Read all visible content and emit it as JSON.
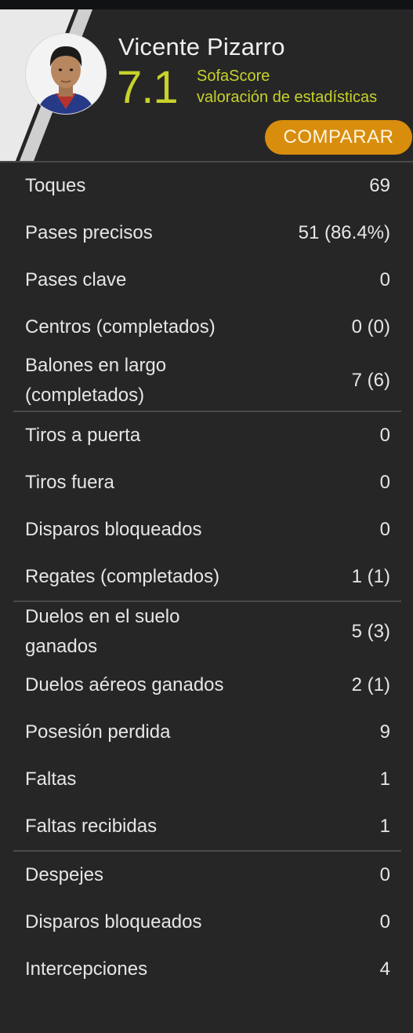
{
  "player": {
    "name": "Vicente Pizarro",
    "rating": "7.1",
    "rating_source_brand": "SofaScore",
    "rating_source_desc": "valoración de estadísticas",
    "compare_label": "COMPARAR"
  },
  "colors": {
    "rating": "#c7d22a",
    "compare_button": "#d88d0d",
    "background": "#262626"
  },
  "stats": [
    {
      "label": "Toques",
      "value": "69"
    },
    {
      "label": "Pases precisos",
      "value": "51 (86.4%)"
    },
    {
      "label": "Pases clave",
      "value": "0"
    },
    {
      "label": "Centros (completados)",
      "value": "0 (0)"
    },
    {
      "label": "Balones en largo (completados)",
      "value": "7 (6)"
    },
    {
      "label": "Tiros a puerta",
      "value": "0"
    },
    {
      "label": "Tiros fuera",
      "value": "0"
    },
    {
      "label": "Disparos bloqueados",
      "value": "0"
    },
    {
      "label": "Regates (completados)",
      "value": "1 (1)"
    },
    {
      "label": "Duelos en el suelo ganados",
      "value": "5 (3)"
    },
    {
      "label": "Duelos aéreos ganados",
      "value": "2 (1)"
    },
    {
      "label": "Posesión perdida",
      "value": "9"
    },
    {
      "label": "Faltas",
      "value": "1"
    },
    {
      "label": "Faltas recibidas",
      "value": "1"
    },
    {
      "label": "Despejes",
      "value": "0"
    },
    {
      "label": "Disparos bloqueados",
      "value": "0"
    },
    {
      "label": "Intercepciones",
      "value": "4"
    }
  ]
}
